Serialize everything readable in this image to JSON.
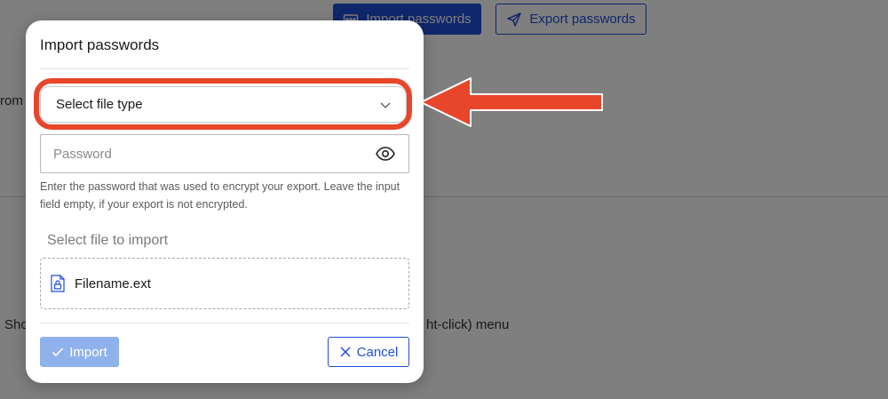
{
  "background": {
    "import_button_label": "Import passwords",
    "export_button_label": "Export passwords",
    "text_fragment_left": "rom",
    "text_fragment_bottom_left": "Sho",
    "text_fragment_bottom_right": "ht-click) menu"
  },
  "dialog": {
    "title": "Import passwords",
    "file_type_select": {
      "value": "Select file type"
    },
    "password": {
      "placeholder": "Password",
      "value": ""
    },
    "helper_text": "Enter the password that was used to encrypt your export. Leave the input field empty, if your export is not encrypted.",
    "file_section_label": "Select file to import",
    "file_name": "Filename.ext",
    "import_button_label": "Import",
    "cancel_button_label": "Cancel"
  },
  "colors": {
    "primary": "#1f4ed8",
    "primary_disabled": "#8fb2ec",
    "annotation": "#e8462b"
  }
}
